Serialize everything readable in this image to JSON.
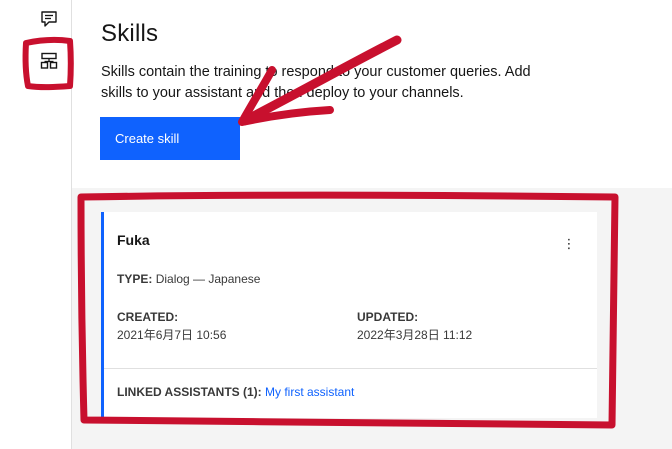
{
  "page": {
    "title": "Skills",
    "description": "Skills contain the training to respond to your customer queries. Add skills to your assistant and then deploy to your channels.",
    "create_button": "Create skill"
  },
  "rail": {
    "icons": [
      "chat-icon",
      "skills-icon"
    ]
  },
  "skill_card": {
    "name": "Fuka",
    "type_label": "TYPE:",
    "type_value": "Dialog — Japanese",
    "created_label": "CREATED:",
    "created_value": "2021年6月7日 10:56",
    "updated_label": "UPDATED:",
    "updated_value": "2022年3月28日 11:12",
    "linked_label": "LINKED ASSISTANTS (1):",
    "linked_value": "My first assistant",
    "overflow_icon": "⋮"
  },
  "colors": {
    "accent": "#0f62fe",
    "annotation": "#d0021b",
    "content_bg": "#f4f4f4"
  }
}
